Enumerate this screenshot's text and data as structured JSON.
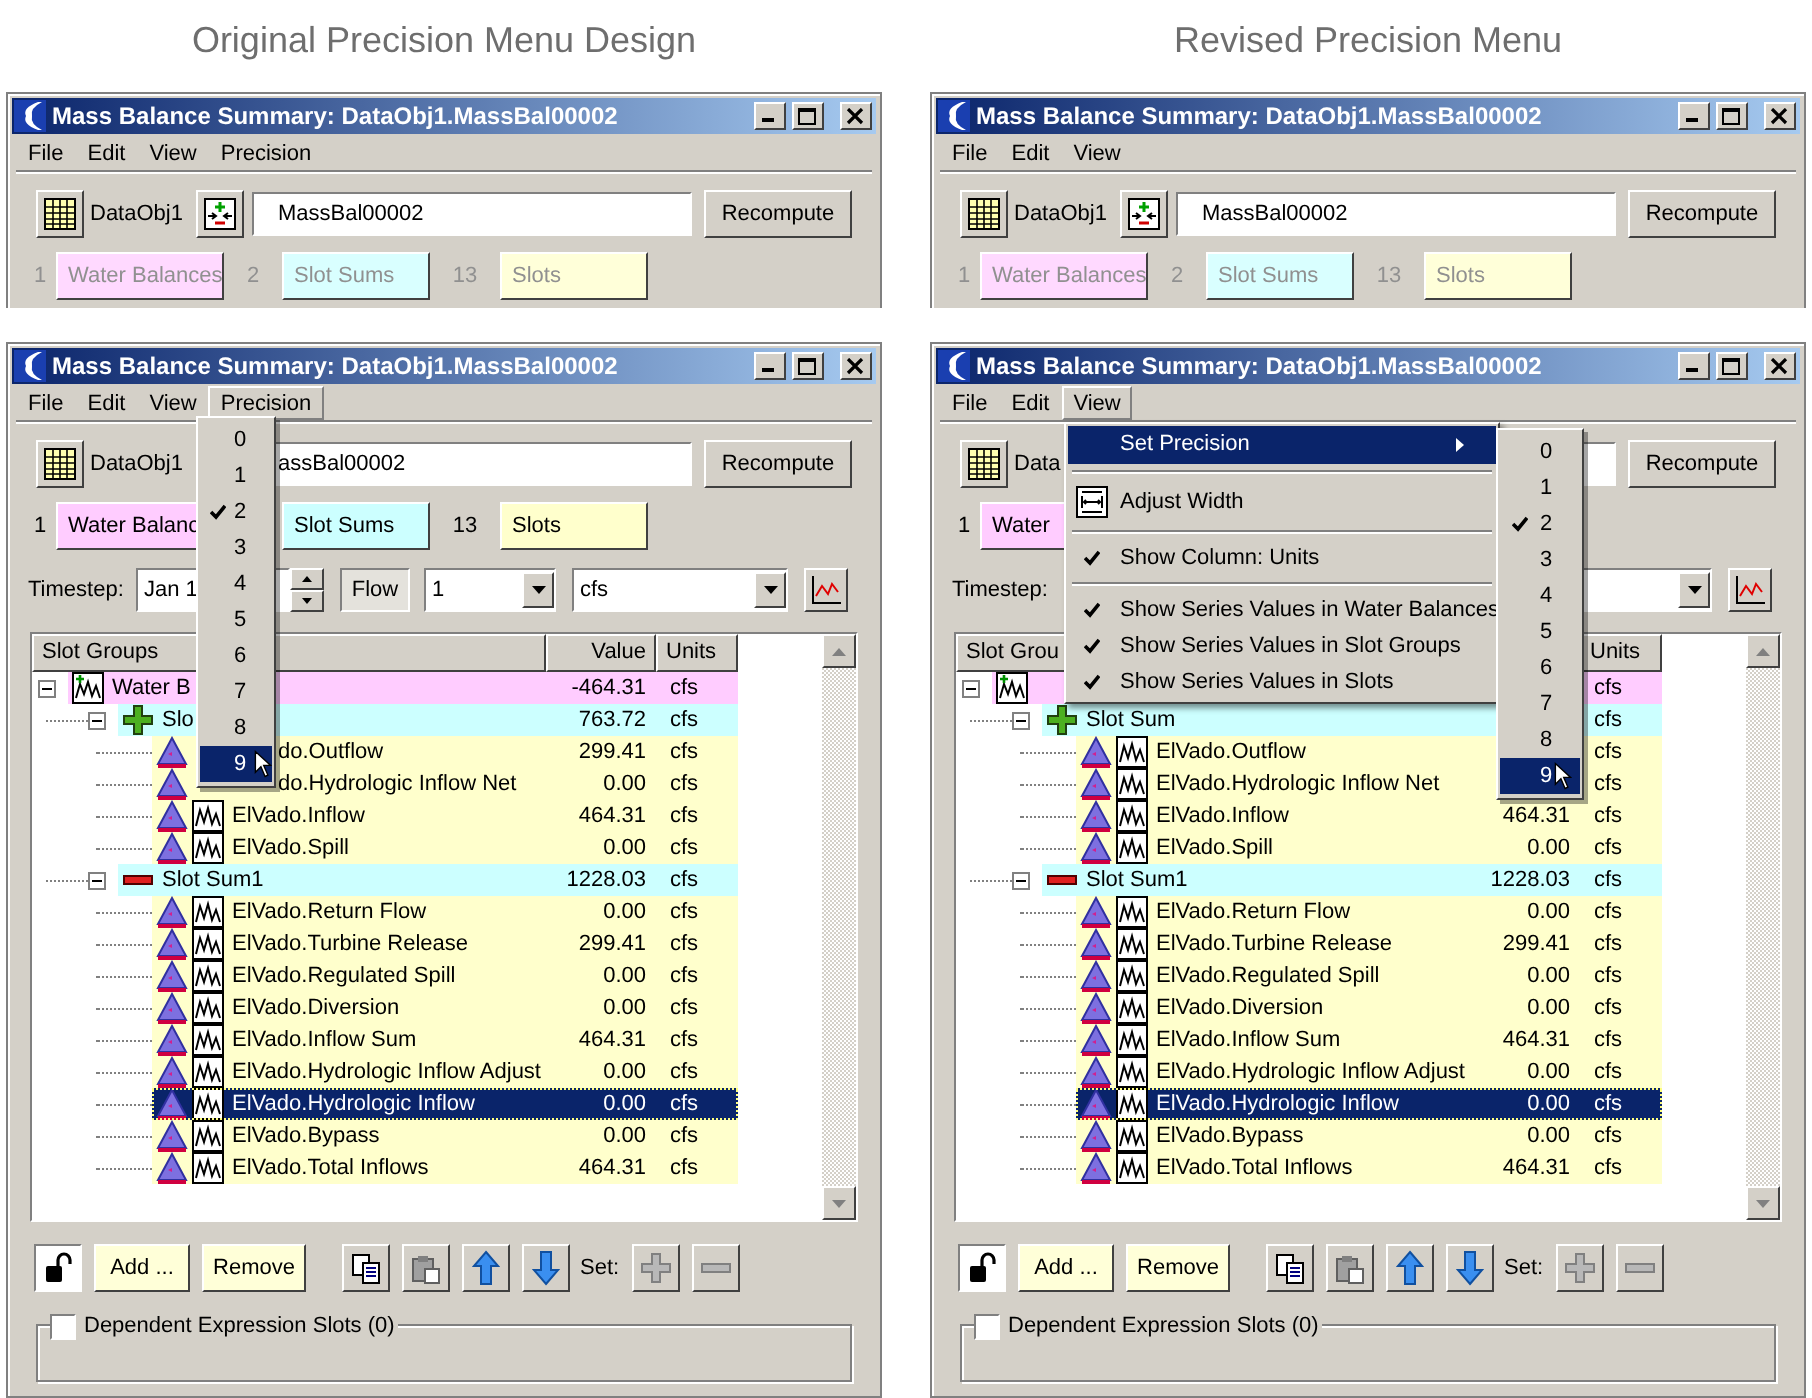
{
  "panels": [
    {
      "heading": "Original Precision Menu Design",
      "preview": {
        "title": "Mass Balance Summary: DataObj1.MassBal00002",
        "menus": [
          {
            "label": "File",
            "open": false
          },
          {
            "label": "Edit",
            "open": false
          },
          {
            "label": "View",
            "open": false
          },
          {
            "label": "Precision",
            "open": false
          }
        ],
        "toolbar": [
          {
            "kind": "table_button"
          },
          {
            "kind": "label",
            "text": "DataObj1"
          },
          {
            "kind": "picker_button"
          },
          {
            "kind": "field",
            "value": "MassBal00002"
          },
          {
            "kind": "button",
            "label": "Recompute"
          }
        ],
        "tabs": [
          {
            "count": "1",
            "label": "Water Balances",
            "color": "#ffd9ff"
          },
          {
            "count": "2",
            "label": "Slot Sums",
            "color": "#d9ffff"
          },
          {
            "count": "13",
            "label": "Slots",
            "color": "#ffffd9"
          }
        ]
      },
      "window": {
        "title": "Mass Balance Summary: DataObj1.MassBal00002",
        "menus": [
          {
            "label": "File",
            "open": false
          },
          {
            "label": "Edit",
            "open": false
          },
          {
            "label": "View",
            "open": false
          },
          {
            "label": "Precision",
            "open": true
          }
        ],
        "toolbar": [
          {
            "kind": "table_button"
          },
          {
            "kind": "label",
            "text": "DataObj1"
          },
          {
            "kind": "field",
            "value": "assBal00002"
          },
          {
            "kind": "button",
            "label": "Recompute"
          }
        ],
        "tabs": [
          {
            "count": "1",
            "label": "Water Balanc",
            "color": "#ffccff"
          },
          {
            "label": "Slot Sums",
            "color": "#ccffff"
          },
          {
            "count": "13",
            "label": "Slots",
            "color": "#ffffcc"
          }
        ],
        "timestep": [
          {
            "kind": "label",
            "text": "Timestep:"
          },
          {
            "kind": "date",
            "value": "Jan 1"
          },
          {
            "kind": "toggle",
            "label": "Flow"
          },
          {
            "kind": "count",
            "value": "1"
          },
          {
            "kind": "units",
            "value": "cfs"
          },
          {
            "kind": "chart_button"
          }
        ],
        "columns": [
          {
            "kind": "name",
            "label": "Slot Groups"
          },
          {
            "kind": "value",
            "label": "Value"
          },
          {
            "kind": "units",
            "label": "Units"
          }
        ],
        "rows": [
          {
            "kind": "balance",
            "name": "Water B",
            "value": "-464.31",
            "units": "cfs",
            "expanded": true,
            "selected": false,
            "children": [
              {
                "kind": "sum_plus",
                "name": "Slo",
                "value": "763.72",
                "units": "cfs",
                "expanded": true,
                "selected": false,
                "children": [
                  {
                    "kind": "slot_partly_hidden",
                    "name": "do.Outflow",
                    "value": "299.41",
                    "units": "cfs",
                    "selected": false
                  },
                  {
                    "kind": "slot_partly_hidden",
                    "name": "do.Hydrologic Inflow Net",
                    "value": "0.00",
                    "units": "cfs",
                    "selected": false
                  },
                  {
                    "kind": "slot",
                    "name": "ElVado.Inflow",
                    "value": "464.31",
                    "units": "cfs",
                    "selected": false
                  },
                  {
                    "kind": "slot",
                    "name": "ElVado.Spill",
                    "value": "0.00",
                    "units": "cfs",
                    "selected": false
                  }
                ]
              },
              {
                "kind": "sum_minus",
                "name": "Slot Sum1",
                "value": "1228.03",
                "units": "cfs",
                "expanded": true,
                "selected": false,
                "children": [
                  {
                    "kind": "slot",
                    "name": "ElVado.Return Flow",
                    "value": "0.00",
                    "units": "cfs",
                    "selected": false
                  },
                  {
                    "kind": "slot",
                    "name": "ElVado.Turbine Release",
                    "value": "299.41",
                    "units": "cfs",
                    "selected": false
                  },
                  {
                    "kind": "slot",
                    "name": "ElVado.Regulated Spill",
                    "value": "0.00",
                    "units": "cfs",
                    "selected": false
                  },
                  {
                    "kind": "slot",
                    "name": "ElVado.Diversion",
                    "value": "0.00",
                    "units": "cfs",
                    "selected": false
                  },
                  {
                    "kind": "slot",
                    "name": "ElVado.Inflow Sum",
                    "value": "464.31",
                    "units": "cfs",
                    "selected": false
                  },
                  {
                    "kind": "slot",
                    "name": "ElVado.Hydrologic Inflow Adjust",
                    "value": "0.00",
                    "units": "cfs",
                    "selected": false
                  },
                  {
                    "kind": "slot",
                    "name": "ElVado.Hydrologic Inflow",
                    "value": "0.00",
                    "units": "cfs",
                    "selected": true
                  },
                  {
                    "kind": "slot",
                    "name": "ElVado.Bypass",
                    "value": "0.00",
                    "units": "cfs",
                    "selected": false
                  },
                  {
                    "kind": "slot",
                    "name": "ElVado.Total Inflows",
                    "value": "464.31",
                    "units": "cfs",
                    "selected": false
                  }
                ]
              }
            ]
          }
        ],
        "buttons": {
          "add": "Add ...",
          "remove": "Remove",
          "set_label": "Set:"
        },
        "dependent": {
          "label": "Dependent Expression Slots (0)",
          "checked": false
        },
        "popup": {
          "kind": "precision",
          "items": [
            {
              "label": "0",
              "checked": false,
              "selected": false
            },
            {
              "label": "1",
              "checked": false,
              "selected": false
            },
            {
              "label": "2",
              "checked": true,
              "selected": false
            },
            {
              "label": "3",
              "checked": false,
              "selected": false
            },
            {
              "label": "4",
              "checked": false,
              "selected": false
            },
            {
              "label": "5",
              "checked": false,
              "selected": false
            },
            {
              "label": "6",
              "checked": false,
              "selected": false
            },
            {
              "label": "7",
              "checked": false,
              "selected": false
            },
            {
              "label": "8",
              "checked": false,
              "selected": false
            },
            {
              "label": "9",
              "checked": false,
              "selected": true
            }
          ]
        }
      }
    },
    {
      "heading": "Revised Precision Menu",
      "preview": {
        "title": "Mass Balance Summary: DataObj1.MassBal00002",
        "menus": [
          {
            "label": "File",
            "open": false
          },
          {
            "label": "Edit",
            "open": false
          },
          {
            "label": "View",
            "open": false
          }
        ],
        "toolbar": [
          {
            "kind": "table_button"
          },
          {
            "kind": "label",
            "text": "DataObj1"
          },
          {
            "kind": "picker_button"
          },
          {
            "kind": "field",
            "value": "MassBal00002"
          },
          {
            "kind": "button",
            "label": "Recompute"
          }
        ],
        "tabs": [
          {
            "count": "1",
            "label": "Water Balances",
            "color": "#ffd9ff"
          },
          {
            "count": "2",
            "label": "Slot Sums",
            "color": "#d9ffff"
          },
          {
            "count": "13",
            "label": "Slots",
            "color": "#ffffd9"
          }
        ]
      },
      "window": {
        "title": "Mass Balance Summary: DataObj1.MassBal00002",
        "menus": [
          {
            "label": "File",
            "open": false
          },
          {
            "label": "Edit",
            "open": false
          },
          {
            "label": "View",
            "open": true
          }
        ],
        "toolbar": [
          {
            "kind": "table_button"
          },
          {
            "kind": "label",
            "text": "Data"
          },
          {
            "kind": "field"
          },
          {
            "kind": "button",
            "label": "Recompute"
          }
        ],
        "tabs": [
          {
            "count": "1",
            "label": "Water",
            "color": "#ffccff"
          }
        ],
        "timestep": [
          {
            "kind": "label",
            "text": "Timestep:"
          },
          {
            "kind": "units"
          },
          {
            "kind": "chart_button"
          }
        ],
        "columns": [
          {
            "kind": "name",
            "label": "Slot Grou"
          },
          {
            "kind": "units",
            "label": "Units"
          }
        ],
        "rows": [
          {
            "kind": "balance",
            "units": "cfs",
            "expanded": true,
            "selected": false,
            "children": [
              {
                "kind": "sum_plus",
                "name": "Slot Sum",
                "units": "cfs",
                "expanded": true,
                "selected": false,
                "children": [
                  {
                    "kind": "slot",
                    "name": "ElVado.Outflow",
                    "units": "cfs",
                    "selected": false
                  },
                  {
                    "kind": "slot",
                    "name": "ElVado.Hydrologic Inflow Net",
                    "units": "cfs",
                    "selected": false
                  },
                  {
                    "kind": "slot",
                    "name": "ElVado.Inflow",
                    "value": "464.31",
                    "units": "cfs",
                    "selected": false
                  },
                  {
                    "kind": "slot",
                    "name": "ElVado.Spill",
                    "value": "0.00",
                    "units": "cfs",
                    "selected": false
                  }
                ]
              },
              {
                "kind": "sum_minus",
                "name": "Slot Sum1",
                "value": "1228.03",
                "units": "cfs",
                "expanded": true,
                "selected": false,
                "children": [
                  {
                    "kind": "slot",
                    "name": "ElVado.Return Flow",
                    "value": "0.00",
                    "units": "cfs",
                    "selected": false
                  },
                  {
                    "kind": "slot",
                    "name": "ElVado.Turbine Release",
                    "value": "299.41",
                    "units": "cfs",
                    "selected": false
                  },
                  {
                    "kind": "slot",
                    "name": "ElVado.Regulated Spill",
                    "value": "0.00",
                    "units": "cfs",
                    "selected": false
                  },
                  {
                    "kind": "slot",
                    "name": "ElVado.Diversion",
                    "value": "0.00",
                    "units": "cfs",
                    "selected": false
                  },
                  {
                    "kind": "slot",
                    "name": "ElVado.Inflow Sum",
                    "value": "464.31",
                    "units": "cfs",
                    "selected": false
                  },
                  {
                    "kind": "slot",
                    "name": "ElVado.Hydrologic Inflow Adjust",
                    "value": "0.00",
                    "units": "cfs",
                    "selected": false
                  },
                  {
                    "kind": "slot",
                    "name": "ElVado.Hydrologic Inflow",
                    "value": "0.00",
                    "units": "cfs",
                    "selected": true
                  },
                  {
                    "kind": "slot",
                    "name": "ElVado.Bypass",
                    "value": "0.00",
                    "units": "cfs",
                    "selected": false
                  },
                  {
                    "kind": "slot",
                    "name": "ElVado.Total Inflows",
                    "value": "464.31",
                    "units": "cfs",
                    "selected": false
                  }
                ]
              }
            ]
          }
        ],
        "buttons": {
          "add": "Add ...",
          "remove": "Remove",
          "set_label": "Set:"
        },
        "dependent": {
          "label": "Dependent Expression Slots (0)",
          "checked": false
        },
        "popup": {
          "kind": "view",
          "items": [
            {
              "kind": "submenu",
              "label": "Set Precision",
              "selected": true
            },
            {
              "kind": "separator"
            },
            {
              "kind": "command",
              "label": "Adjust Width",
              "selected": false
            },
            {
              "kind": "separator"
            },
            {
              "kind": "check",
              "label": "Show Column: Units",
              "checked": true,
              "selected": false
            },
            {
              "kind": "separator"
            },
            {
              "kind": "check",
              "label": "Show Series Values in Water Balances",
              "checked": true,
              "selected": false
            },
            {
              "kind": "check",
              "label": "Show Series Values in Slot Groups",
              "checked": true,
              "selected": false
            },
            {
              "kind": "check",
              "label": "Show Series Values in Slots",
              "checked": true,
              "selected": false
            }
          ],
          "submenu": [
            {
              "label": "0",
              "checked": false,
              "selected": false
            },
            {
              "label": "1",
              "checked": false,
              "selected": false
            },
            {
              "label": "2",
              "checked": true,
              "selected": false
            },
            {
              "label": "3",
              "checked": false,
              "selected": false
            },
            {
              "label": "4",
              "checked": false,
              "selected": false
            },
            {
              "label": "5",
              "checked": false,
              "selected": false
            },
            {
              "label": "6",
              "checked": false,
              "selected": false
            },
            {
              "label": "7",
              "checked": false,
              "selected": false
            },
            {
              "label": "8",
              "checked": false,
              "selected": false
            },
            {
              "label": "9",
              "checked": false,
              "selected": true
            }
          ]
        }
      }
    }
  ]
}
